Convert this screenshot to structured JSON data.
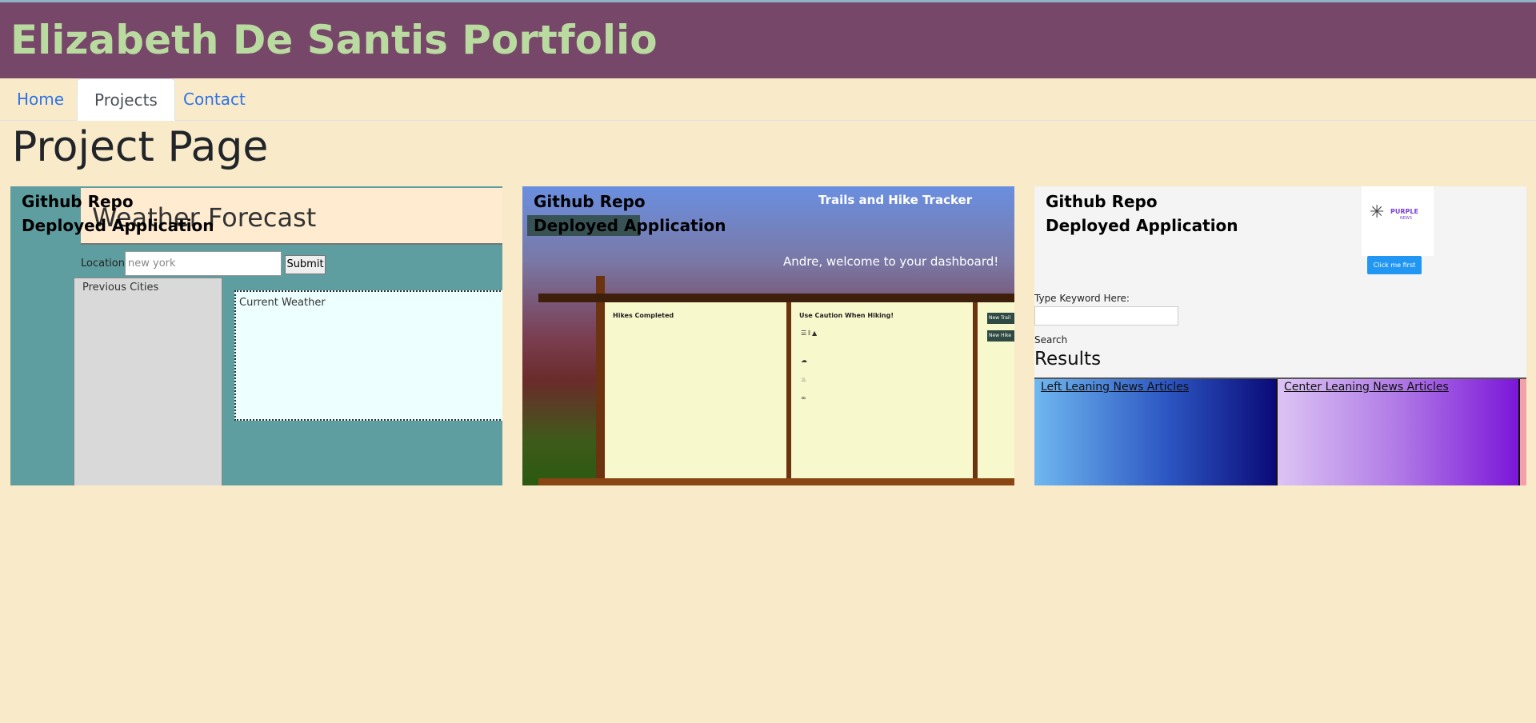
{
  "header": {
    "title": "Elizabeth De Santis Portfolio"
  },
  "nav": {
    "tabs": [
      {
        "label": "Home"
      },
      {
        "label": "Projects"
      },
      {
        "label": "Contact"
      }
    ]
  },
  "page": {
    "title": "Project Page"
  },
  "projects": [
    {
      "github_label": "Github Repo",
      "deployed_label": "Deployed Application",
      "preview": {
        "title": "Weather Forecast",
        "location_label": "Location:",
        "location_value": "new york",
        "submit_label": "Submit",
        "previous_cities_label": "Previous Cities",
        "current_weather_label": "Current Weather"
      }
    },
    {
      "github_label": "Github Repo",
      "deployed_label": "Deployed Application",
      "preview": {
        "title": "Trails and Hike Tracker",
        "welcome": "Andre, welcome to your dashboard!",
        "panel1_title": "Hikes Completed",
        "panel2_title": "Use Caution When Hiking!",
        "button1": "New Trail",
        "button2": "New Hike"
      }
    },
    {
      "github_label": "Github Repo",
      "deployed_label": "Deployed Application",
      "preview": {
        "logo_text": "PURPLE",
        "logo_sub": "NEWS",
        "click_button": "Click me first",
        "keyword_label": "Type Keyword Here:",
        "search_label": "Search",
        "results_label": "Results",
        "left_link": "Left Leaning News Articles",
        "center_link": "Center Leaning News Articles"
      }
    }
  ],
  "colors": {
    "background": "#f9ebca",
    "banner": "#77476a",
    "banner_text": "#b9dba0",
    "link": "#2f73e6"
  }
}
